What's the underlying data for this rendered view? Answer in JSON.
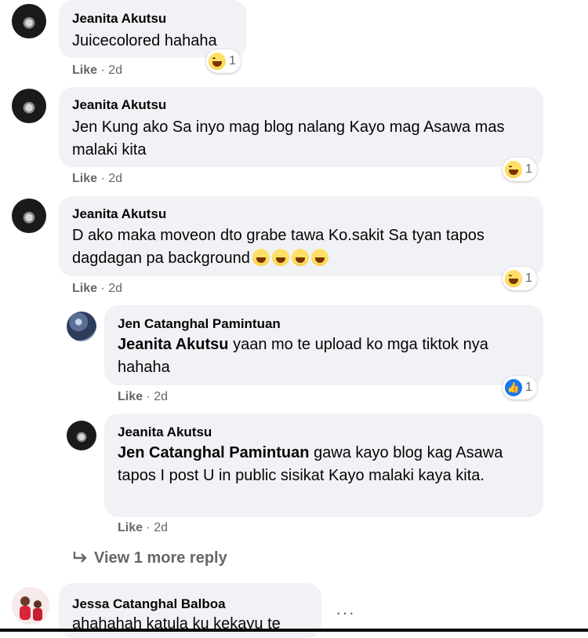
{
  "comments": [
    {
      "author": "Jeanita Akutsu",
      "text": "Juicecolored hahaha",
      "like_label": "Like",
      "time": "2d",
      "reaction_count": "1"
    },
    {
      "author": "Jeanita Akutsu",
      "text": "Jen Kung ako Sa inyo mag blog nalang Kayo mag Asawa mas malaki kita",
      "like_label": "Like",
      "time": "2d",
      "reaction_count": "1"
    },
    {
      "author": "Jeanita Akutsu",
      "text": "D ako maka moveon dto grabe tawa Ko.sakit Sa tyan tapos dagdagan pa background",
      "like_label": "Like",
      "time": "2d",
      "reaction_count": "1"
    }
  ],
  "replies": [
    {
      "author": "Jen Catanghal Pamintuan",
      "mention": "Jeanita Akutsu",
      "text": "yaan mo te upload ko mga tiktok nya hahaha",
      "like_label": "Like",
      "time": "2d",
      "reaction_count": "1"
    },
    {
      "author": "Jeanita Akutsu",
      "mention": "Jen Catanghal Pamintuan",
      "text": "gawa kayo blog kag Asawa tapos I post U in public sisikat Kayo malaki kaya kita.",
      "like_label": "Like",
      "time": "2d"
    }
  ],
  "view_more_label": "View 1 more reply",
  "next_comment": {
    "author": "Jessa Catanghal Balboa",
    "text": "ahahahah katula ku kekayu te"
  },
  "meta_separator": "·",
  "more_dots": "···"
}
